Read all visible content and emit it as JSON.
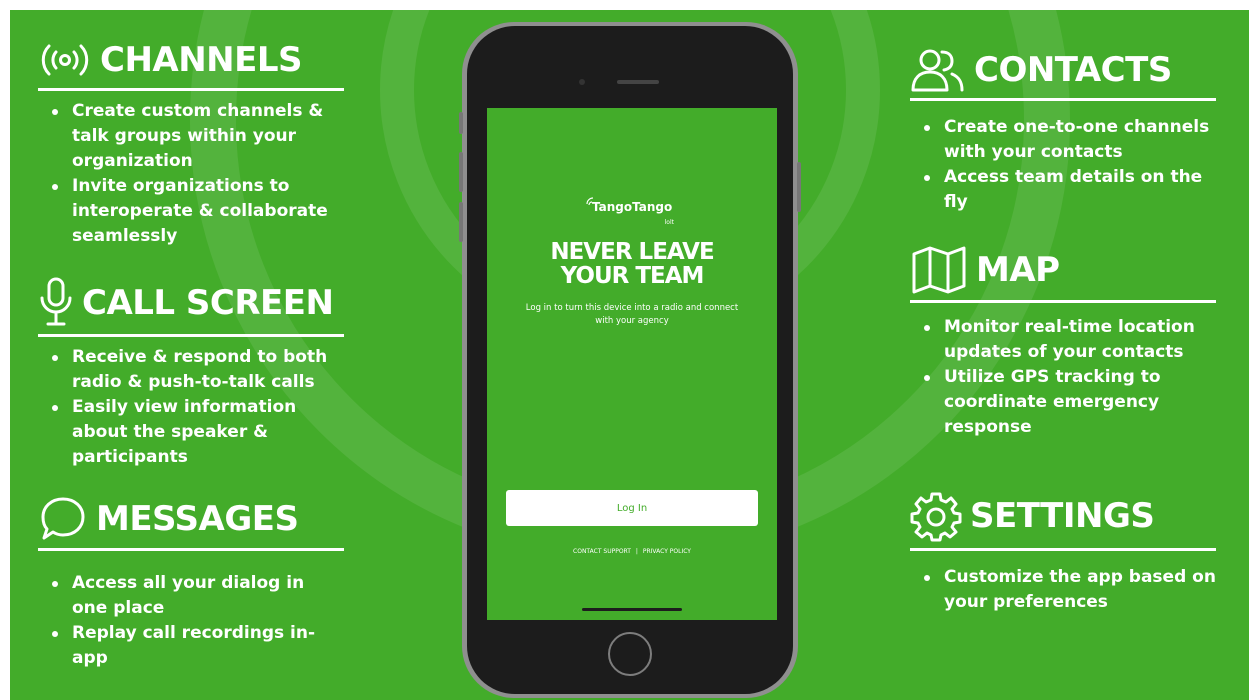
{
  "colors": {
    "background": "#43ac2a",
    "foreground": "#ffffff",
    "phone_frame": "#1c1c1c"
  },
  "sections": {
    "channels": {
      "icon": "radio-broadcast-icon",
      "title": "CHANNELS",
      "bullets": [
        "Create custom channels & talk groups within your organization",
        "Invite organizations to interoperate & collaborate seamlessly"
      ]
    },
    "call_screen": {
      "icon": "microphone-icon",
      "title": "CALL SCREEN",
      "bullets": [
        "Receive & respond to both radio & push-to-talk calls",
        "Easily view information about the speaker & participants"
      ]
    },
    "messages": {
      "icon": "chat-bubble-icon",
      "title": "MESSAGES",
      "bullets": [
        "Access all your dialog in one place",
        "Replay call recordings in-app"
      ]
    },
    "contacts": {
      "icon": "users-icon",
      "title": "CONTACTS",
      "bullets": [
        "Create one-to-one channels with your contacts",
        "Access team details on the fly"
      ]
    },
    "map": {
      "icon": "map-icon",
      "title": "MAP",
      "bullets": [
        "Monitor real-time location updates of your contacts",
        "Utilize GPS tracking to coordinate emergency response"
      ]
    },
    "settings": {
      "icon": "gear-icon",
      "title": "SETTINGS",
      "bullets": [
        "Customize the app based on your preferences"
      ]
    }
  },
  "phone": {
    "logo": {
      "text": "TangoTango",
      "sub": "lolt",
      "icon": "signal-wave-icon"
    },
    "headline": [
      "NEVER LEAVE",
      "YOUR TEAM"
    ],
    "tagline": "Log in to turn this device into a radio and connect with your agency",
    "login_button": "Log In",
    "links": {
      "support": "CONTACT SUPPORT",
      "separator": "|",
      "privacy": "PRIVACY POLICY"
    }
  }
}
